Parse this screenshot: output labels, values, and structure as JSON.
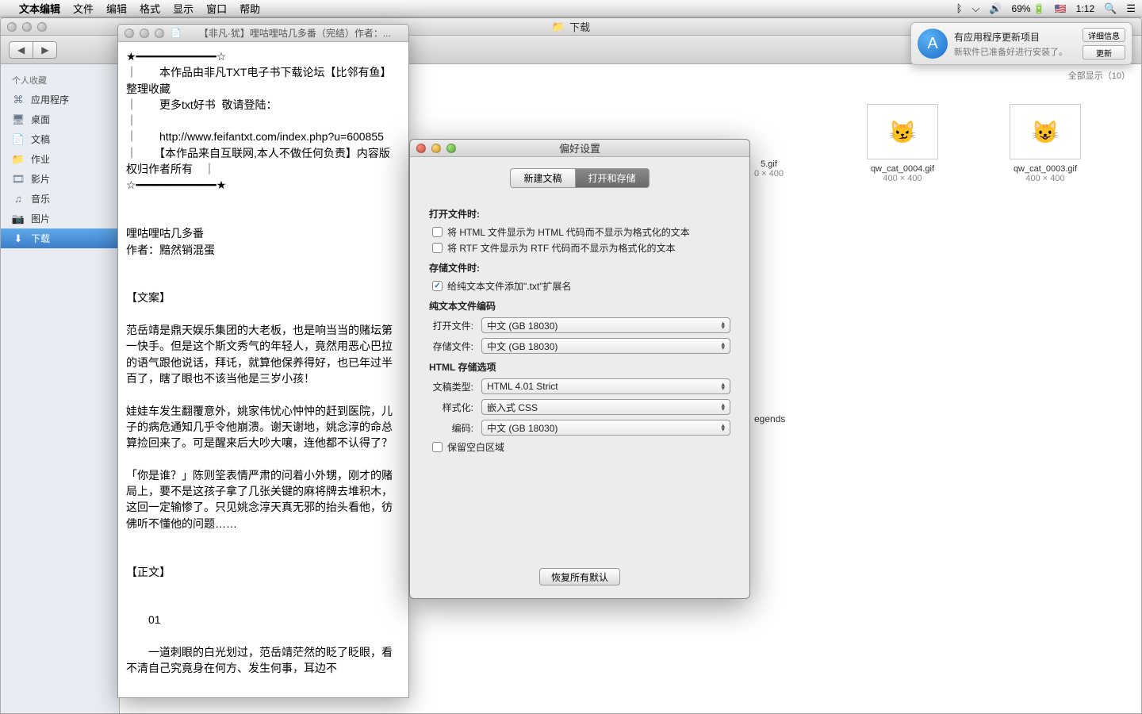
{
  "menubar": {
    "app": "文本编辑",
    "items": [
      "文件",
      "编辑",
      "格式",
      "显示",
      "窗口",
      "帮助"
    ],
    "battery": "69%",
    "time": "1:12",
    "flag": "🇺🇸"
  },
  "finder": {
    "title": "下载",
    "sidebar_header": "个人收藏",
    "sidebar": [
      {
        "icon": "🅰",
        "label": "应用程序"
      },
      {
        "icon": "🖥",
        "label": "桌面"
      },
      {
        "icon": "📄",
        "label": "文稿"
      },
      {
        "icon": "📁",
        "label": "作业"
      },
      {
        "icon": "🎞",
        "label": "影片"
      },
      {
        "icon": "🎵",
        "label": "音乐"
      },
      {
        "icon": "📷",
        "label": "图片"
      },
      {
        "icon": "⬇",
        "label": "下载"
      }
    ],
    "show_all": "全部显示（10）",
    "thumbs": [
      {
        "name": "qw_cat_0004.gif",
        "dim": "400 × 400"
      },
      {
        "name": "qw_cat_0003.gif",
        "dim": "400 × 400"
      }
    ],
    "partial": {
      "name": "5.gif",
      "dim": "0 × 400"
    },
    "legends": "egends"
  },
  "textedit": {
    "title": "【非凡·犹】哩咕哩咕几多番（完结）作者：...",
    "body": "★━━━━━━━━━━━━☆\n｜　　本作品由非凡TXT电子书下载论坛【比邻有鱼】整理收藏\n｜　　更多txt好书  敬请登陆：\n｜\n｜　　http://www.feifantxt.com/index.php?u=600855\n｜　　【本作品来自互联网,本人不做任何负责】内容版权归作者所有　｜\n☆━━━━━━━━━━━━★\n\n\n哩咕哩咕几多番\n作者：黯然销混蛋\n\n\n【文案】\n\n范岳靖是鼎天娱乐集团的大老板，也是响当当的赌坛第一快手。但是这个斯文秀气的年轻人，竟然用恶心巴拉的语气跟他说话，拜讬，就算他保养得好，也已年过半百了，瞎了眼也不该当他是三岁小孩！\n\n娃娃车发生翻覆意外，姚家伟忧心忡忡的赶到医院，儿子的病危通知几乎令他崩溃。谢天谢地，姚念淳的命总算捡回来了。可是醒来后大吵大嚷，连他都不认得了？\n\n「你是谁？」陈则筌表情严肃的问着小外甥，刚才的赌局上，要不是这孩子拿了几张关键的麻将牌去堆积木，这回一定输惨了。只见姚念淳天真无邪的抬头看他，彷佛听不懂他的问题……\n\n\n【正文】\n\n\n　　01\n\n　　一道刺眼的白光划过，范岳靖茫然的眨了眨眼，看不清自己究竟身在何方、发生何事，耳边不"
  },
  "prefs": {
    "title": "偏好设置",
    "tabs": {
      "a": "新建文稿",
      "b": "打开和存储"
    },
    "open_header": "打开文件时:",
    "cb_html": "将 HTML 文件显示为 HTML 代码而不显示为格式化的文本",
    "cb_rtf": "将 RTF 文件显示为 RTF 代码而不显示为格式化的文本",
    "save_header": "存储文件时:",
    "cb_ext": "给纯文本文件添加\".txt\"扩展名",
    "enc_header": "纯文本文件编码",
    "open_label": "打开文件:",
    "save_label": "存储文件:",
    "enc_value": "中文 (GB 18030)",
    "html_header": "HTML 存储选项",
    "doctype_label": "文稿类型:",
    "doctype_value": "HTML 4.01 Strict",
    "style_label": "样式化:",
    "style_value": "嵌入式 CSS",
    "encoding_label": "编码:",
    "cb_blank": "保留空白区域",
    "restore": "恢复所有默认"
  },
  "notif": {
    "title": "有应用程序更新项目",
    "sub": "新软件已准备好进行安装了。",
    "btn_detail": "详细信息",
    "btn_update": "更新"
  }
}
